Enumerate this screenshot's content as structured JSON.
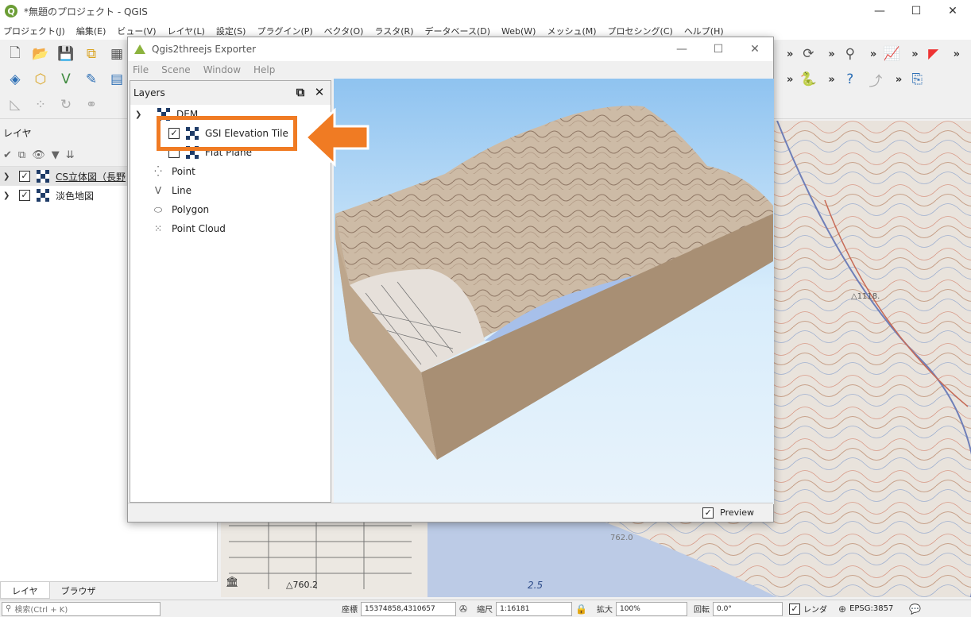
{
  "window": {
    "title": "*無題のプロジェクト - QGIS",
    "logo": "Q",
    "controls": [
      "—",
      "☐",
      "✕"
    ]
  },
  "menu": [
    "プロジェクト(J)",
    "編集(E)",
    "ビュー(V)",
    "レイヤ(L)",
    "設定(S)",
    "プラグイン(P)",
    "ベクタ(O)",
    "ラスタ(R)",
    "データベース(D)",
    "Web(W)",
    "メッシュ(M)",
    "プロセシング(C)",
    "ヘルプ(H)"
  ],
  "toolbar": {
    "overflow": "»"
  },
  "layer_panel": {
    "title": "レイヤ",
    "layers": [
      {
        "name": "CS立体図（長野",
        "checked": true,
        "selected": true
      },
      {
        "name": "淡色地図",
        "checked": true,
        "selected": false
      }
    ],
    "tabs": [
      "レイヤ",
      "ブラウザ"
    ]
  },
  "dialog": {
    "title": "Qgis2threejs Exporter",
    "controls": [
      "—",
      "☐",
      "✕"
    ],
    "menu": [
      "File",
      "Scene",
      "Window",
      "Help"
    ],
    "layers_title": "Layers",
    "dem_group": "DEM",
    "dem_items": [
      {
        "name": "GSI Elevation Tile",
        "checked": true
      },
      {
        "name": "Flat Plane",
        "checked": false
      }
    ],
    "groups": [
      "Point",
      "Line",
      "Polygon",
      "Point Cloud"
    ],
    "preview_label": "Preview",
    "preview_checked": true
  },
  "map": {
    "labels": [
      "△1118.",
      "△760.2",
      "2.5",
      "762.0",
      "2.5"
    ]
  },
  "statusbar": {
    "search_placeholder": "検索(Ctrl + K)",
    "coord_label": "座標",
    "coord_value": "15374858,4310657",
    "scale_label": "縮尺",
    "scale_value": "1:16181",
    "magnifier_label": "拡大",
    "magnifier_value": "100%",
    "rotation_label": "回転",
    "rotation_value": "0.0°",
    "render_label": "レンダ",
    "crs": "EPSG:3857"
  },
  "colors": {
    "highlight": "#f07b23",
    "sky_top": "#8fc3f0",
    "terrain_side": "#a88f74"
  }
}
